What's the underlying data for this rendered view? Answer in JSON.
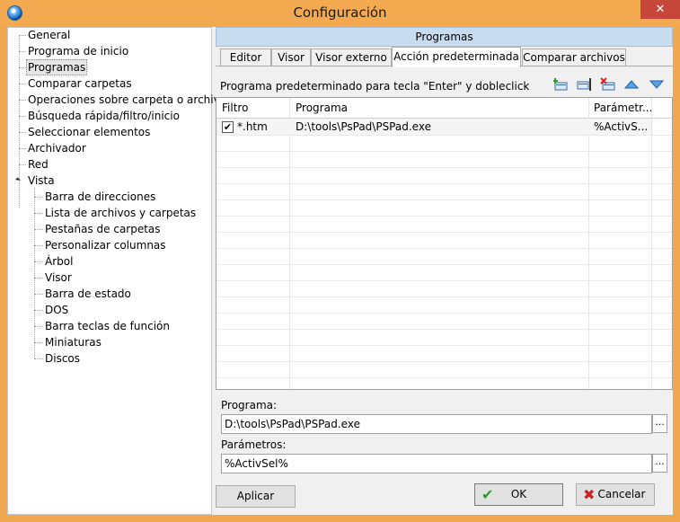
{
  "window": {
    "title": "Configuración",
    "close_glyph": "✕"
  },
  "tree": {
    "items": [
      {
        "label": "General"
      },
      {
        "label": "Programa de inicio"
      },
      {
        "label": "Programas",
        "selected": true
      },
      {
        "label": "Comparar carpetas"
      },
      {
        "label": "Operaciones sobre carpeta o archivo"
      },
      {
        "label": "Búsqueda rápida/filtro/inicio"
      },
      {
        "label": "Seleccionar elementos"
      },
      {
        "label": "Archivador"
      },
      {
        "label": "Red"
      },
      {
        "label": "Vista",
        "expanded": true
      }
    ],
    "children": [
      {
        "label": "Barra de direcciones"
      },
      {
        "label": "Lista de archivos y carpetas"
      },
      {
        "label": "Pestañas de carpetas"
      },
      {
        "label": "Personalizar columnas"
      },
      {
        "label": "Árbol"
      },
      {
        "label": "Visor"
      },
      {
        "label": "Barra de estado"
      },
      {
        "label": "DOS"
      },
      {
        "label": "Barra teclas de función"
      },
      {
        "label": "Miniaturas"
      },
      {
        "label": "Discos"
      }
    ]
  },
  "panel": {
    "header": "Programas",
    "tabs": [
      {
        "label": "Editor"
      },
      {
        "label": "Visor"
      },
      {
        "label": "Visor externo"
      },
      {
        "label": "Acción predeterminada",
        "active": true
      },
      {
        "label": "Comparar archivos"
      }
    ],
    "description": "Programa predeterminado para tecla \"Enter\" y dobleclick",
    "toolbar_icons": [
      "add-icon",
      "edit-icon",
      "delete-icon",
      "move-up-icon",
      "move-down-icon"
    ],
    "grid": {
      "columns": [
        "Filtro",
        "Programa",
        "Parámetr..."
      ],
      "rows": [
        {
          "checked": true,
          "filtro": "*.htm",
          "programa": "D:\\tools\\PsPad\\PSPad.exe",
          "parametros": "%ActivS..."
        }
      ]
    },
    "programa_label": "Programa:",
    "programa_value": "D:\\tools\\PsPad\\PSPad.exe",
    "parametros_label": "Parámetros:",
    "parametros_value": "%ActivSel%",
    "ellipsis": "..."
  },
  "buttons": {
    "apply": "Aplicar",
    "ok": "OK",
    "cancel": "Cancelar"
  },
  "colors": {
    "titlebar": "#f3a94f",
    "close": "#c7463a",
    "panel_header": "#c8dcf0",
    "ok_glyph": "#2e9a2e",
    "cancel_glyph": "#cc2222"
  }
}
